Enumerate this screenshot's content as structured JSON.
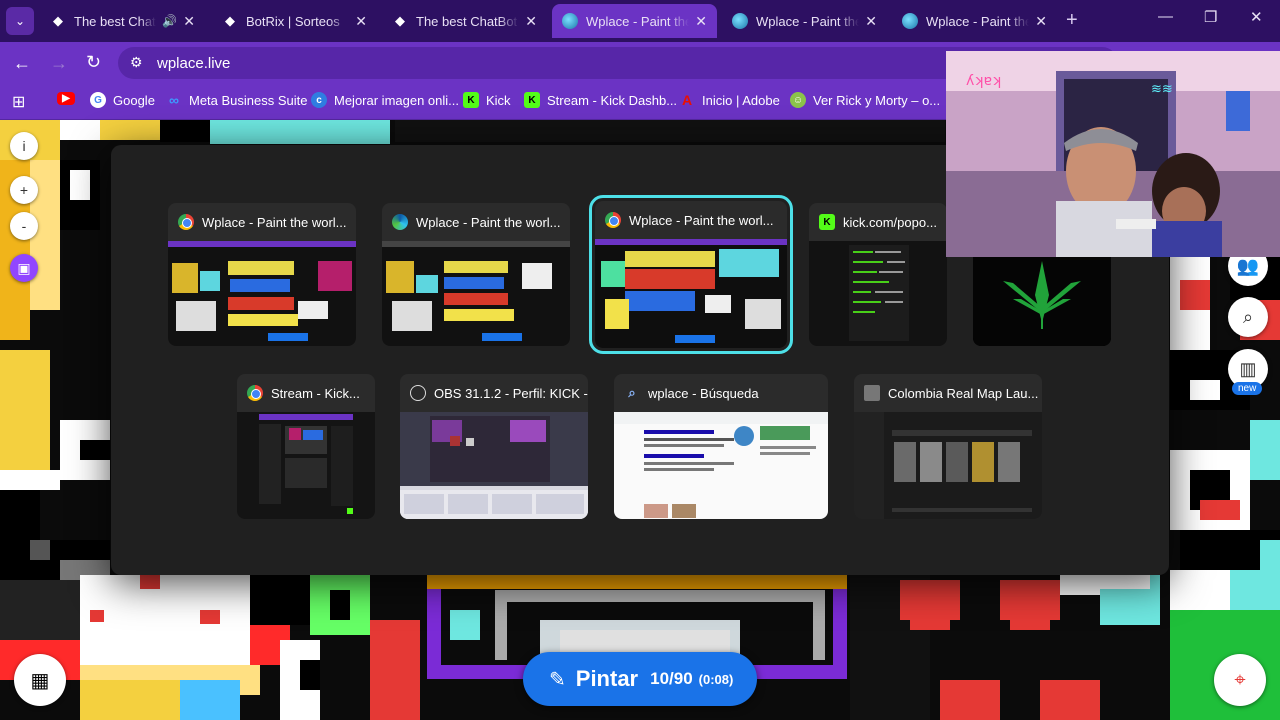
{
  "browser": {
    "tabs": [
      {
        "title": "The best ChatBot",
        "icon": "botrix-icon",
        "audio": true,
        "active": false
      },
      {
        "title": "BotRix | Sorteos",
        "icon": "botrix-icon",
        "audio": false,
        "active": false
      },
      {
        "title": "The best ChatBot e",
        "icon": "botrix-icon",
        "audio": false,
        "active": false
      },
      {
        "title": "Wplace - Paint the",
        "icon": "globe-icon",
        "audio": false,
        "active": true
      },
      {
        "title": "Wplace - Paint the",
        "icon": "globe-icon",
        "audio": false,
        "active": false
      },
      {
        "title": "Wplace - Paint the",
        "icon": "globe-icon",
        "audio": false,
        "active": false
      }
    ],
    "url": "wplace.live",
    "bookmarks": [
      {
        "label": "",
        "icon": "youtube-icon",
        "color": "#ff0000"
      },
      {
        "label": "Google",
        "icon": "google-icon",
        "color": "#ffffff"
      },
      {
        "label": "Meta Business Suite",
        "icon": "meta-icon",
        "color": "#0a7cff"
      },
      {
        "label": "Mejorar imagen onli...",
        "icon": "enhance-icon",
        "color": "#2f7de1"
      },
      {
        "label": "Kick",
        "icon": "kick-icon",
        "color": "#53fc18"
      },
      {
        "label": "Stream - Kick Dashb...",
        "icon": "kick-icon",
        "color": "#53fc18"
      },
      {
        "label": "Inicio | Adobe",
        "icon": "adobe-icon",
        "color": "#eb1000"
      },
      {
        "label": "Ver Rick y Morty – o...",
        "icon": "rick-morty-icon",
        "color": "#8bc34a"
      }
    ]
  },
  "switcher": {
    "row1": [
      {
        "title": "Wplace - Paint the worl...",
        "app": "chrome",
        "selected": false
      },
      {
        "title": "Wplace - Paint the worl...",
        "app": "edge",
        "selected": false
      },
      {
        "title": "Wplace - Paint the worl...",
        "app": "chrome",
        "selected": true
      },
      {
        "title": "kick.com/popo...",
        "app": "kick",
        "selected": false
      },
      {
        "title": "",
        "app": "none",
        "selected": false
      }
    ],
    "row2": [
      {
        "title": "Stream - Kick...",
        "app": "chrome"
      },
      {
        "title": "OBS 31.1.2 - Perfil: KICK -...",
        "app": "obs"
      },
      {
        "title": "wplace - Búsqueda",
        "app": "search"
      },
      {
        "title": "Colombia Real Map Lau...",
        "app": "app"
      }
    ]
  },
  "paint": {
    "label": "Pintar",
    "count": "10/90",
    "timer": "(0:08)"
  },
  "right_panel": {
    "new_badge": "new"
  },
  "left_controls": [
    {
      "label": "i",
      "icon": "info-icon"
    },
    {
      "label": "+",
      "icon": "zoom-in-icon"
    },
    {
      "label": "-",
      "icon": "zoom-out-icon"
    }
  ]
}
